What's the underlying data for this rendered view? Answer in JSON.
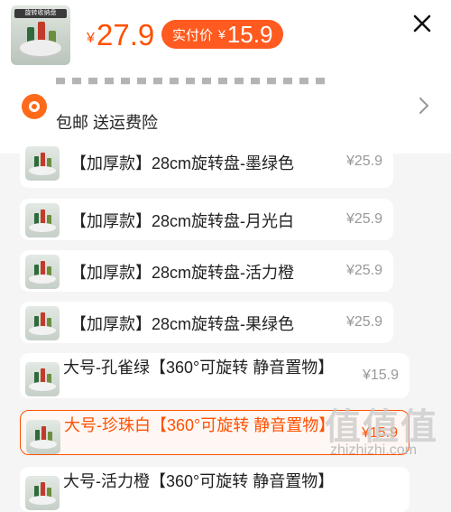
{
  "product": {
    "price_symbol": "¥",
    "price": "27.9",
    "actual_price_label": "实付价",
    "actual_price_symbol": "¥",
    "actual_price": "15.9",
    "thumb_tag": "旋转收纳盘"
  },
  "address": {
    "shipping_text": "包邮  送运费险"
  },
  "options": [
    {
      "label": "【加厚款】28cm旋转盘-墨绿色",
      "price": "¥25.9",
      "selected": false
    },
    {
      "label": "【加厚款】28cm旋转盘-月光白",
      "price": "¥25.9",
      "selected": false
    },
    {
      "label": "【加厚款】28cm旋转盘-活力橙",
      "price": "¥25.9",
      "selected": false
    },
    {
      "label": "【加厚款】28cm旋转盘-果绿色",
      "price": "¥25.9",
      "selected": false
    },
    {
      "label": "大号-孔雀绿【360°可旋转 静音置物】",
      "price": "¥15.9",
      "selected": false
    },
    {
      "label": "大号-珍珠白【360°可旋转 静音置物】",
      "price": "¥15.9",
      "selected": true
    },
    {
      "label": "大号-活力橙【360°可旋转 静音置物】",
      "price": "",
      "selected": false
    }
  ],
  "watermark": {
    "glyphs": "值值值",
    "site": "zhizhizhi.com"
  },
  "colors": {
    "accent": "#ff5000",
    "pill": "#ff5a1f",
    "muted_price": "#999999"
  }
}
